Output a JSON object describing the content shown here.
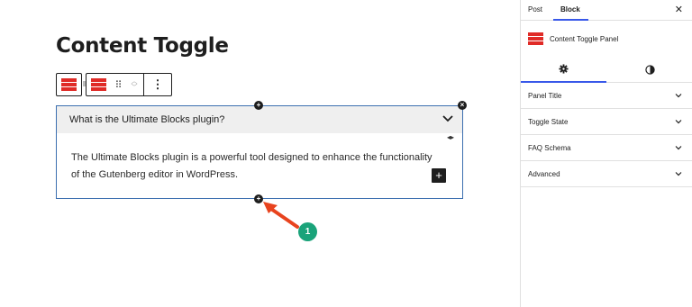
{
  "editor": {
    "title": "Content Toggle",
    "toggle": {
      "question": "What is the Ultimate Blocks plugin?",
      "answer": "The Ultimate Blocks plugin is a powerful tool designed to enhance the functionality of the Gutenberg editor in WordPress."
    },
    "callout_number": "1"
  },
  "toolbar": {
    "icons": [
      "parent-block-icon",
      "content-toggle-icon",
      "drag-handle-icon",
      "move-up-icon",
      "move-down-icon",
      "more-options-icon"
    ]
  },
  "sidebar": {
    "tabs": [
      "Post",
      "Block"
    ],
    "active_tab": "Block",
    "block_name": "Content Toggle Panel",
    "panels": [
      "Panel Title",
      "Toggle State",
      "FAQ Schema",
      "Advanced"
    ]
  },
  "colors": {
    "accent": "#3858e9",
    "block_border": "#3c6fb0",
    "brand_red": "#e02b27",
    "callout": "#1aa37a",
    "arrow": "#e8431e"
  }
}
